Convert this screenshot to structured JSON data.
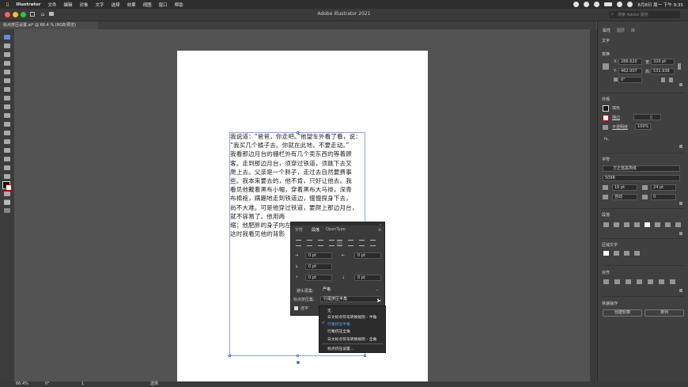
{
  "menubar": {
    "app": "Illustrator",
    "items": [
      "文件",
      "编辑",
      "对象",
      "文字",
      "选择",
      "效果",
      "视图",
      "窗口",
      "帮助"
    ],
    "datetime": "8月8日 周一 下午 9:35"
  },
  "window": {
    "title": "Adobe Illustrator 2021"
  },
  "document_tab": {
    "label": "标点挤压设置.ai* @ 66.4 % (RGB/预览)"
  },
  "artboard": {
    "lines": [
      "我说道：“爸爸，你走吧。”他望车外看了看，说：",
      "“我买几个橘子去。你就在此地，不要走动。”",
      "我看那边月台的栅栏外有几个卖东西的等着顾",
      "客。走到那边月台，须穿过铁道，须跳下去又",
      "爬上去。父亲是一个胖子，走过去自然要费事",
      "些。我本来要去的，他不肯，只好让他去。我",
      "看见他戴着黑布小帽，穿着黑布大马褂，深青",
      "布棉袍，蹒跚地走到铁道边，慢慢探身下去，",
      "尚不大难。可是他穿过铁道，要爬上那边月台，",
      "就不容易了。他用两",
      "缩；他肥胖的身子向左",
      "这时我看见他的背影"
    ]
  },
  "paragraph_panel": {
    "tabs": [
      "字符",
      "段落",
      "OpenType"
    ],
    "left_indent": "0 pt",
    "right_indent": "0 pt",
    "first_indent": "0 pt",
    "space_before": "0 pt",
    "space_after": "0 pt",
    "kinsoku_label": "避头尾集:",
    "kinsoku_value": "严格",
    "mojikumi_label": "标点挤压集:",
    "mojikumi_value": "行尾挤压半角",
    "hyphenate_label": "连字"
  },
  "mojikumi_menu": {
    "items": [
      "无",
      "日文标点符号转换规则 - 半角",
      "行尾挤压半角",
      "行尾挤压全角",
      "日文标点符号转换规则 - 全角",
      "标点挤压设置..."
    ],
    "selected_index": 2
  },
  "right_panel": {
    "tabs": [
      "属性",
      "图层",
      "库"
    ],
    "search_placeholder": "搜索 Adobe 服务",
    "section_text": "文字",
    "transform": {
      "title": "变换",
      "x_label": "X:",
      "x": "286.620",
      "w_label": "宽:",
      "w": "320 pt",
      "y_label": "Y:",
      "y": "462.007",
      "h_label": "高:",
      "h": "531.938",
      "angle": "0°"
    },
    "appearance": {
      "title": "外观",
      "fill": "填色",
      "stroke": "描边",
      "opacity_label": "不透明度",
      "opacity": "100%",
      "fx": "fx."
    },
    "character": {
      "title": "字符",
      "font": "方正悠黑简体",
      "style": "509R",
      "size": "16 pt",
      "leading": "24 pt",
      "tracking_mode": "自动",
      "tracking": "0"
    },
    "paragraph_title": "段落",
    "area_type_title": "区域文字",
    "align_title": "对齐",
    "quick_actions": {
      "title": "快速操作",
      "create_outlines": "创建轮廓",
      "arrange": "排列"
    }
  },
  "status": {
    "zoom": "66.4%",
    "angle": "0°",
    "page": "1",
    "tool": "选择"
  },
  "colors": {
    "accent": "#4b6fd6",
    "menu_selected": "#5aa0ff",
    "traffic_red": "#ff5f57",
    "traffic_yellow": "#febc2e",
    "traffic_green": "#28c840"
  }
}
